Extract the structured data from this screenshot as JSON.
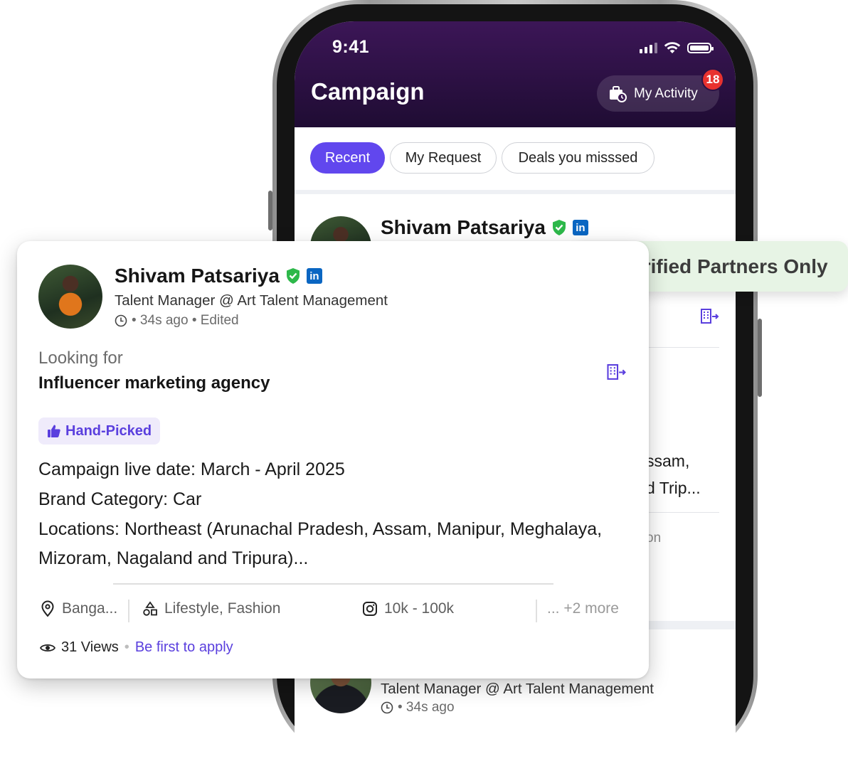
{
  "status_bar": {
    "time": "9:41"
  },
  "header": {
    "title": "Campaign",
    "activity_label": "My Activity",
    "activity_badge": "18"
  },
  "tabs": [
    {
      "label": "Recent",
      "active": true
    },
    {
      "label": "My Request",
      "active": false
    },
    {
      "label": "Deals you misssed",
      "active": false
    }
  ],
  "background_cards": [
    {
      "name": "Shivam Patsariya",
      "partial_lines": [
        "ssam,",
        "d Trip...",
        "on"
      ]
    },
    {
      "subtitle": "Talent Manager @ Art Talent Management",
      "meta": "• 34s ago"
    }
  ],
  "verified_banner": {
    "label": "Verified Partners Only"
  },
  "card": {
    "name": "Shivam Patsariya",
    "linkedin_label": "in",
    "subtitle": "Talent Manager @ Art Talent Management",
    "meta": "• 34s ago • Edited",
    "looking_label": "Looking for",
    "looking_value": "Influencer marketing agency",
    "tag": "Hand-Picked",
    "details": [
      "Campaign live date: March - April 2025",
      "Brand Category: Car",
      "Locations: Northeast (Arunachal Pradesh, Assam, Manipur, Meghalaya,",
      "Mizoram, Nagaland and Tripura)..."
    ],
    "location": "Banga...",
    "categories": "Lifestyle, Fashion",
    "followers": "10k - 100k",
    "more": "... +2 more",
    "views": "31 Views",
    "apply_label": "Be first to apply"
  },
  "colors": {
    "accent": "#6147ee",
    "header": "#2a0f40",
    "verified_bg": "#e7f4e5",
    "badge": "#e8322f",
    "shield_green": "#2db84a",
    "linkedin": "#0a66c2"
  }
}
